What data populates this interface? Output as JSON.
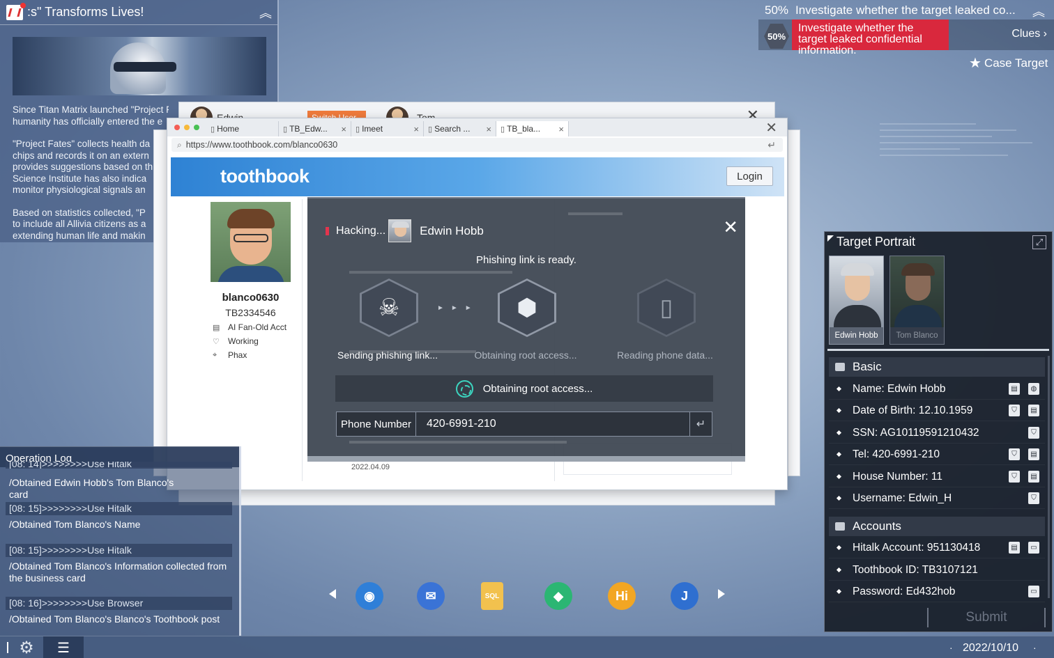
{
  "news": {
    "title": ":s\" Transforms Lives!",
    "paragraphs": [
      "Since Titan Matrix launched \"Project F\nhumanity has officially entered the e",
      "\"Project Fates\" collects health da\nchips and records it on an extern\nprovides suggestions based on th\nScience Institute has also indica\nmonitor physiological signals an",
      "Based on statistics collected, \"P\nto include all Allivia citizens as a\nextending human life and makin"
    ]
  },
  "objective": {
    "percent_top": "50%",
    "title_top": "Investigate whether the target leaked co...",
    "percent": "50%",
    "text": "Investigate whether the target leaked confidential information.",
    "clues": "Clues",
    "case_target": "Case Target"
  },
  "back_window": {
    "user1": "Edwin",
    "switch": "Switch User",
    "user2": "Tom"
  },
  "browser": {
    "tabs": [
      {
        "label": "Home",
        "closable": false
      },
      {
        "label": "TB_Edw...",
        "closable": true
      },
      {
        "label": "Imeet",
        "closable": true
      },
      {
        "label": "Search ...",
        "closable": true
      },
      {
        "label": "TB_bla...",
        "closable": true,
        "active": true
      }
    ],
    "url": "https://www.toothbook.com/blanco0630",
    "logo": "toothbook",
    "login": "Login"
  },
  "profile": {
    "username": "blanco0630",
    "id": "TB2334546",
    "info": [
      {
        "icon": "calendar-icon",
        "glyph": "▤",
        "text": "AI Fan-Old Acct"
      },
      {
        "icon": "heart-icon",
        "glyph": "♡",
        "text": "Working"
      },
      {
        "icon": "location-icon",
        "glyph": "⌖",
        "text": "Phax"
      }
    ],
    "feed_date": "2022.04.09"
  },
  "hacking": {
    "label": "Hacking...",
    "target": "Edwin Hobb",
    "status": "Phishing link is ready.",
    "steps": [
      {
        "icon": "skull-icon",
        "glyph": "☠",
        "label": "Sending phishing link..."
      },
      {
        "icon": "box-icon",
        "glyph": "⬢",
        "label": "Obtaining root access..."
      },
      {
        "icon": "phone-icon",
        "glyph": "▯",
        "label": "Reading phone data..."
      }
    ],
    "progress": "Obtaining root access...",
    "phone_label": "Phone Number",
    "phone_value": "420-6991-210"
  },
  "portrait": {
    "title": "Target Portrait",
    "cards": [
      {
        "name": "Edwin Hobb",
        "selected": true
      },
      {
        "name": "Tom Blanco",
        "selected": false
      }
    ],
    "basic_title": "Basic",
    "basic": [
      {
        "text": "Name: Edwin Hobb",
        "actions": [
          "doc-icon",
          "globe-icon"
        ]
      },
      {
        "text": "Date of Birth: 12.10.1959",
        "actions": [
          "shield-icon",
          "doc-icon"
        ]
      },
      {
        "text": "SSN: AG10119591210432",
        "actions": [
          "shield-icon"
        ]
      },
      {
        "text": "Tel: 420-6991-210",
        "actions": [
          "shield-icon",
          "doc-icon"
        ]
      },
      {
        "text": "House Number: 11",
        "actions": [
          "shield-icon",
          "doc-icon"
        ]
      },
      {
        "text": "Username: Edwin_H",
        "actions": [
          "shield-icon"
        ]
      }
    ],
    "accounts_title": "Accounts",
    "accounts": [
      {
        "text": "Hitalk Account: 951130418",
        "actions": [
          "doc-icon",
          "chat-icon"
        ]
      },
      {
        "text": "Toothbook ID: TB3107121",
        "actions": []
      },
      {
        "text": "Password: Ed432hob",
        "actions": [
          "chat-icon"
        ]
      }
    ],
    "submit": "Submit"
  },
  "oplog": {
    "title": "Operation Log",
    "entries": [
      {
        "ts": "[08: 14]>>>>>>>>Use Hitalk",
        "msg": "/Obtained Edwin Hobb's Tom Blanco's\ncard"
      },
      {
        "ts": "[08: 15]>>>>>>>>Use Hitalk",
        "msg": "/Obtained Tom Blanco's Name"
      },
      {
        "ts": "[08: 15]>>>>>>>>Use Hitalk",
        "msg": "/Obtained Tom Blanco's Information collected from\nthe business card"
      },
      {
        "ts": "[08: 16]>>>>>>>>Use Browser",
        "msg": "/Obtained Tom Blanco's Blanco's Toothbook post"
      }
    ]
  },
  "dock": [
    {
      "name": "browser-app-icon",
      "glyph": "◉",
      "bg": "#2f7fd8"
    },
    {
      "name": "mail-app-icon",
      "glyph": "✉",
      "bg": "#3a73d6"
    },
    {
      "name": "sql-app-icon",
      "glyph": "SQL",
      "bg": "#f2c14e"
    },
    {
      "name": "vpn-app-icon",
      "glyph": "◆",
      "bg": "#2bb673"
    },
    {
      "name": "hitalk-app-icon",
      "glyph": "Hi",
      "bg": "#f2a623"
    },
    {
      "name": "hook-app-icon",
      "glyph": "J",
      "bg": "#2f6fd0"
    }
  ],
  "taskbar": {
    "date": "2022/10/10"
  }
}
